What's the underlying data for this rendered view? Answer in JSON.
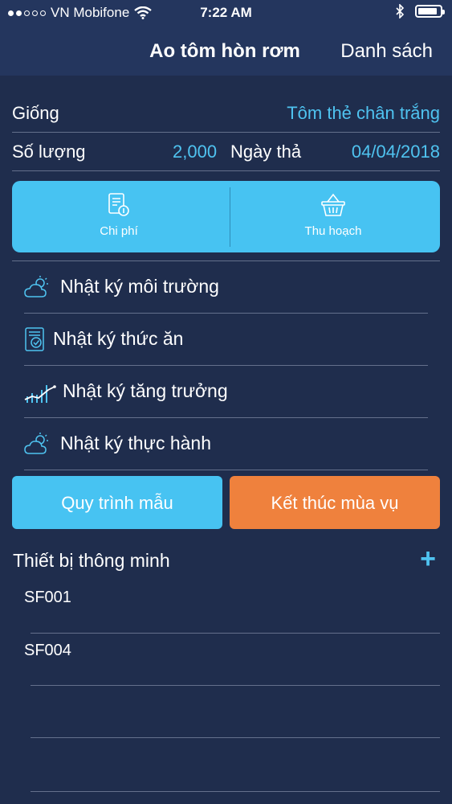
{
  "status": {
    "carrier": "VN Mobifone",
    "time": "7:22 AM",
    "battery_level": 0.9
  },
  "nav": {
    "title": "Ao  tôm hòn rơm",
    "right_link": "Danh sách"
  },
  "info": {
    "species_label": "Giống",
    "species_value": "Tôm thẻ chân trắng",
    "quantity_label": "Số lượng",
    "quantity_value": "2,000",
    "release_label": "Ngày thả",
    "release_value": "04/04/2018"
  },
  "actions": {
    "cost_label": "Chi phí",
    "harvest_label": "Thu hoạch"
  },
  "logs": [
    {
      "label": "Nhật ký môi trường",
      "icon": "cloud-sun-icon"
    },
    {
      "label": "Nhật ký thức ăn",
      "icon": "document-check-icon"
    },
    {
      "label": "Nhật ký tăng trưởng",
      "icon": "growth-chart-icon"
    },
    {
      "label": "Nhật ký thực hành",
      "icon": "cloud-sun-icon"
    }
  ],
  "buttons": {
    "template_process": "Quy trình mẫu",
    "end_season": "Kết thúc mùa vụ"
  },
  "devices": {
    "title": "Thiết bị thông minh",
    "add_symbol": "+",
    "items": [
      "SF001",
      "SF004"
    ]
  },
  "colors": {
    "background": "#1f2d4d",
    "header": "#24365e",
    "accent_blue": "#47c3f2",
    "text_blue": "#4fc3f0",
    "accent_orange": "#ef813d"
  }
}
